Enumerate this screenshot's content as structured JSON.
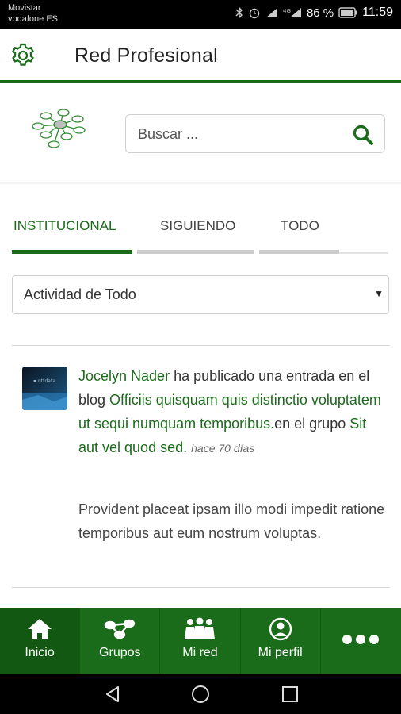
{
  "status_bar": {
    "carrier_line1": "Movistar",
    "carrier_line2": "vodafone ES",
    "battery": "86 %",
    "time": "11:59"
  },
  "header": {
    "title": "Red Profesional",
    "settings_icon": "gear-icon"
  },
  "search": {
    "placeholder": "Buscar ..."
  },
  "tabs": [
    {
      "label": "INSTITUCIONAL",
      "active": true
    },
    {
      "label": "SIGUIENDO",
      "active": false
    },
    {
      "label": "TODO",
      "active": false
    }
  ],
  "filter": {
    "selected": "Actividad de Todo"
  },
  "activity": {
    "author": "Jocelyn Nader",
    "action": " ha publicado una entrada en el blog ",
    "post_title": "Officiis quisquam quis distinctio voluptatem ut sequi numquam temporibus.",
    "group_prefix": "en el grupo ",
    "group_name": "Sit aut vel quod sed.",
    "time": "hace 70 días",
    "excerpt": "Provident placeat ipsam illo modi impedit ratione temporibus aut eum nostrum voluptas."
  },
  "bottom_nav": [
    {
      "label": "Inicio",
      "icon": "home-icon",
      "active": true
    },
    {
      "label": "Grupos",
      "icon": "groups-icon",
      "active": false
    },
    {
      "label": "Mi red",
      "icon": "network-icon",
      "active": false
    },
    {
      "label": "Mi perfil",
      "icon": "profile-icon",
      "active": false
    },
    {
      "label": "",
      "icon": "more-icon",
      "active": false
    }
  ],
  "colors": {
    "brand_green": "#1a6b1a",
    "tab_inactive": "#cccccc"
  }
}
